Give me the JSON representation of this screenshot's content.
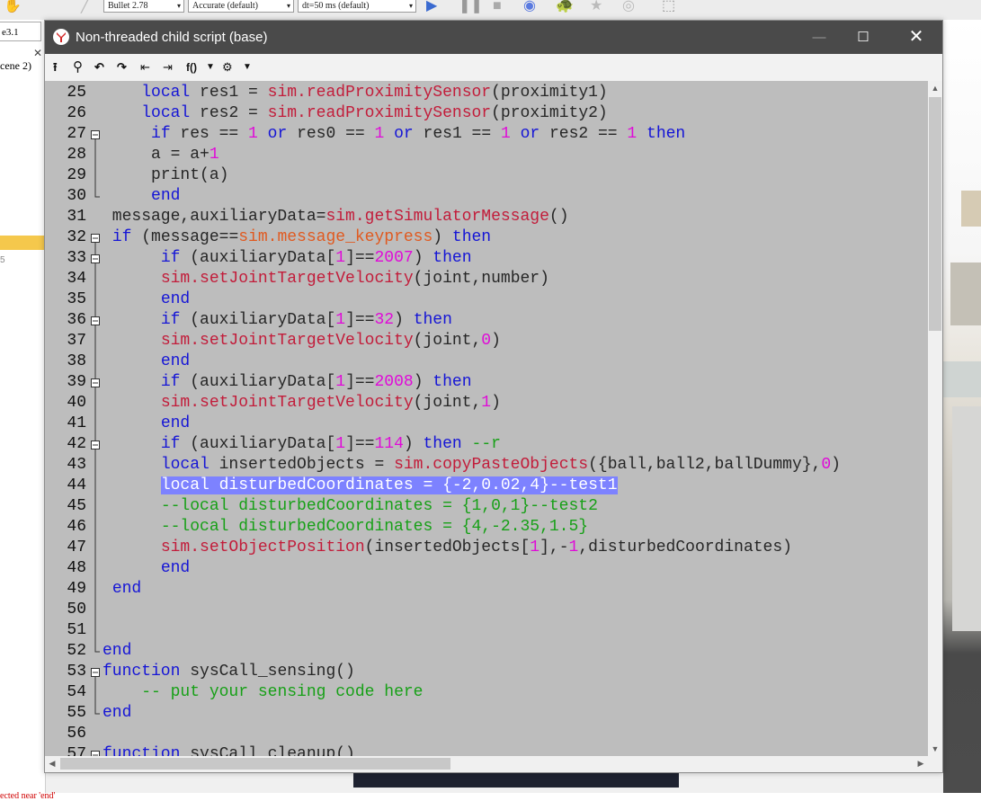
{
  "background": {
    "combo1": "Bullet 2.78",
    "combo2": "Accurate (default)",
    "combo3": "dt=50 ms (default)",
    "tab1": "e3.1",
    "tab2": "cene 2)",
    "number": "5",
    "status_text": "ected near 'end'"
  },
  "window": {
    "title": "Non-threaded child script (base)"
  },
  "toolbar": {
    "fx_label": "f()"
  }
}
